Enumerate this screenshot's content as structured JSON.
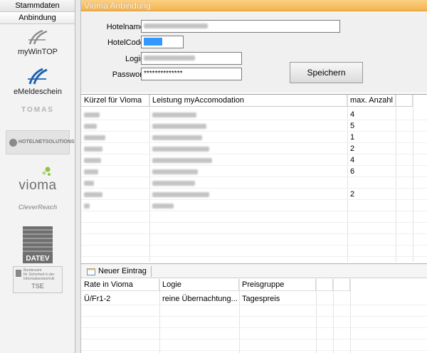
{
  "sidebar": {
    "tabs": [
      "Stammdaten",
      "Anbindung"
    ],
    "modules": {
      "mywintop": "myWinTOP",
      "emeldeschein": "eMeldeschein",
      "tomas": "TOMAS",
      "hotelnetsolutions": "HOTELNETSOLUTIONS",
      "vioma": "vioma",
      "cleverreach": "CleverReach",
      "datev": "DATEV",
      "tse_line1": "Bundesamt",
      "tse_line2": "für Sicherheit in der",
      "tse_line3": "Informationstechnik",
      "tse": "TSE"
    }
  },
  "main": {
    "title": "Vioma Anbindung",
    "form": {
      "hotelname_label": "Hotelname:",
      "hotelcode_label": "HotelCode:",
      "login_label": "Login:",
      "password_label": "Passwort:",
      "password_value": "**************",
      "save_label": "Speichern"
    },
    "services_grid": {
      "columns": [
        "Kürzel für Vioma",
        "Leistung myAccomodation",
        "max. Anzahl"
      ],
      "max_values": [
        "4",
        "5",
        "1",
        "2",
        "4",
        "6",
        "",
        "2",
        ""
      ]
    },
    "toolbar": {
      "new_entry": "Neuer Eintrag"
    },
    "rates_grid": {
      "columns": [
        "Rate in Vioma",
        "Logie",
        "Preisgruppe"
      ],
      "rows": [
        {
          "rate": "Ü/Fr1-2",
          "logie": "reine Übernachtung...",
          "preisgruppe": "Tagespreis"
        }
      ]
    }
  },
  "colors": {
    "title_bar": "#f4b34f",
    "title_text": "#ffffff",
    "selection": "#3399ff"
  }
}
